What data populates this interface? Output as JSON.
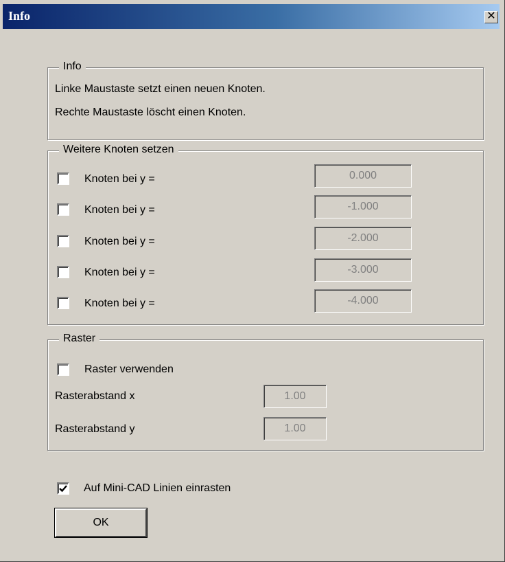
{
  "window": {
    "title": "Info",
    "close_symbol": "✕"
  },
  "info_group": {
    "legend": "Info",
    "line1": "Linke Maustaste setzt einen neuen Knoten.",
    "line2": "Rechte Maustaste löscht einen Knoten."
  },
  "nodes_group": {
    "legend": "Weitere Knoten setzen",
    "rows": [
      {
        "label": "Knoten bei y =",
        "value": "0.000",
        "checked": false
      },
      {
        "label": "Knoten bei y =",
        "value": "-1.000",
        "checked": false
      },
      {
        "label": "Knoten bei y =",
        "value": "-2.000",
        "checked": false
      },
      {
        "label": "Knoten bei y =",
        "value": "-3.000",
        "checked": false
      },
      {
        "label": "Knoten bei y =",
        "value": "-4.000",
        "checked": false
      }
    ]
  },
  "raster_group": {
    "legend": "Raster",
    "use_label": "Raster verwenden",
    "use_checked": false,
    "x_label": "Rasterabstand x",
    "x_value": "1.00",
    "y_label": "Rasterabstand y",
    "y_value": "1.00"
  },
  "snap": {
    "label": "Auf Mini-CAD Linien einrasten",
    "checked": true
  },
  "ok_label": "OK"
}
